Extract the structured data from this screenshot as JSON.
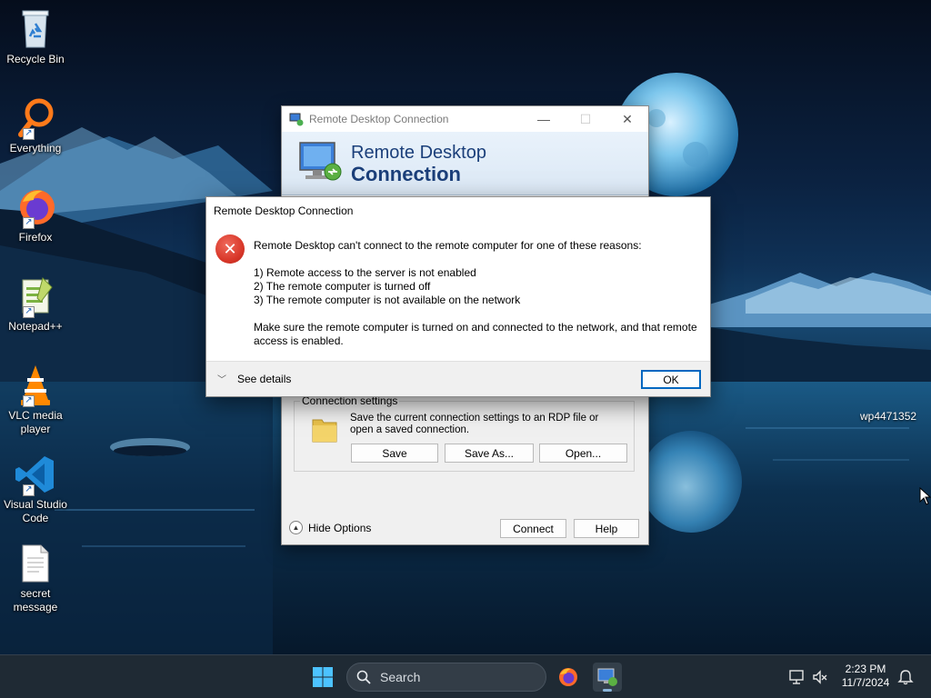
{
  "desktop": {
    "icons": [
      {
        "label": "Recycle Bin",
        "icon": "recycle-bin-icon"
      },
      {
        "label": "Everything",
        "icon": "everything-search-icon"
      },
      {
        "label": "Firefox",
        "icon": "firefox-icon"
      },
      {
        "label": "Notepad++",
        "icon": "notepad-plus-plus-icon"
      },
      {
        "label": "VLC media player",
        "icon": "vlc-icon"
      },
      {
        "label": "Visual Studio Code",
        "icon": "vscode-icon"
      },
      {
        "label": "secret message",
        "icon": "text-file-icon"
      }
    ],
    "wallpaper_label": "wp4471352"
  },
  "rdp_window": {
    "title": "Remote Desktop Connection",
    "banner_line1": "Remote Desktop",
    "banner_line2": "Connection",
    "connection_settings": {
      "legend": "Connection settings",
      "description": "Save the current connection settings to an RDP file or open a saved connection.",
      "save_label": "Save",
      "save_as_label": "Save As...",
      "open_label": "Open..."
    },
    "hide_options_label": "Hide Options",
    "connect_label": "Connect",
    "help_label": "Help"
  },
  "error_dialog": {
    "title": "Remote Desktop Connection",
    "message_intro": "Remote Desktop can't connect to the remote computer for one of these reasons:",
    "reasons": [
      "1) Remote access to the server is not enabled",
      "2) The remote computer is turned off",
      "3) The remote computer is not available on the network"
    ],
    "message_advice": "Make sure the remote computer is turned on and connected to the network, and that remote access is enabled.",
    "see_details_label": "See details",
    "ok_label": "OK"
  },
  "taskbar": {
    "search_placeholder": "Search",
    "time": "2:23 PM",
    "date": "11/7/2024"
  },
  "colors": {
    "banner_text": "#1b3f7a",
    "error_red": "#d9382a",
    "taskbar": "#1f2a34",
    "accent": "#0067c0"
  }
}
